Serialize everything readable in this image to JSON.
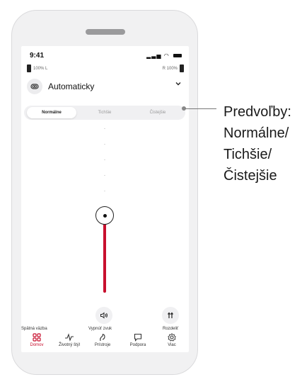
{
  "status": {
    "time": "9:41"
  },
  "battery": {
    "left_label": "100% L",
    "right_label": "R 100%"
  },
  "program": {
    "name": "Automaticky"
  },
  "presets": {
    "tabs": [
      {
        "label": "Normálne",
        "active": true
      },
      {
        "label": "Tichšie",
        "active": false
      },
      {
        "label": "Čistejšie",
        "active": false
      }
    ]
  },
  "volume": {
    "level_fraction": 0.47
  },
  "actions": {
    "feedback_label": "Spätná väzba",
    "mute_label": "Vypnúť zvuk",
    "split_label": "Rozdeliť"
  },
  "nav": {
    "items": [
      {
        "label": "Domov",
        "icon": "home-grid-icon",
        "active": true
      },
      {
        "label": "Životný štýl",
        "icon": "lifestyle-pulse-icon",
        "active": false
      },
      {
        "label": "Prístroje",
        "icon": "hearing-aid-icon",
        "active": false
      },
      {
        "label": "Podpora",
        "icon": "chat-icon",
        "active": false
      },
      {
        "label": "Viac",
        "icon": "gear-icon",
        "active": false
      }
    ]
  },
  "callout": {
    "lines": [
      "Predvoľby:",
      "Normálne/",
      "Tichšie/",
      "Čistejšie"
    ]
  },
  "colors": {
    "accent": "#c8102e"
  }
}
